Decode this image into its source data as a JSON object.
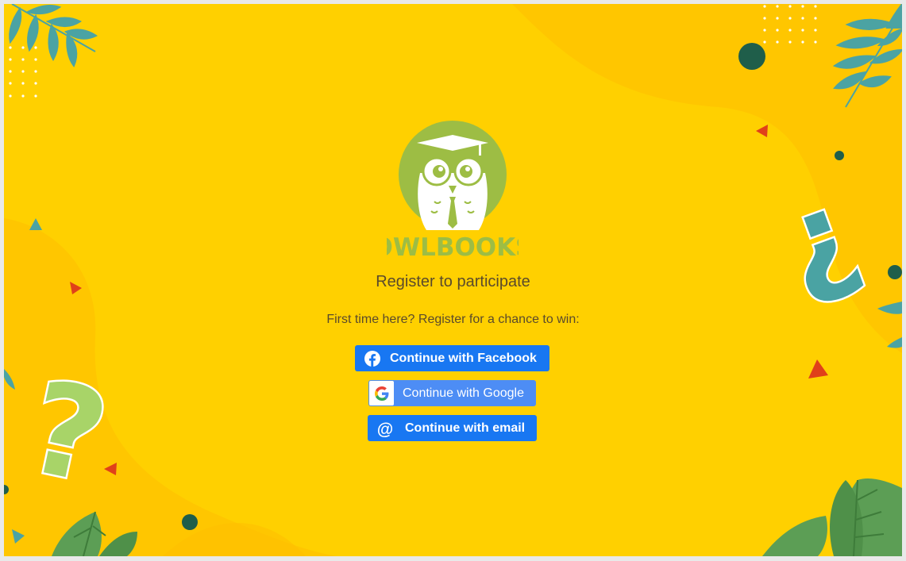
{
  "brand": {
    "name": "OWLBOOKS"
  },
  "register": {
    "title": "Register to participate",
    "subtitle": "First time here? Register for a chance to win:"
  },
  "buttons": {
    "facebook": {
      "label": "Continue with Facebook",
      "icon": "facebook-icon"
    },
    "google": {
      "label": "Continue with Google",
      "icon": "google-icon"
    },
    "email": {
      "label": "Continue with email",
      "icon": "at-sign-icon",
      "icon_glyph": "@"
    }
  },
  "decor": {
    "left_mark": "?",
    "right_mark": "¿"
  },
  "colors": {
    "background": "#ffd000",
    "facebook": "#1877f2",
    "google": "#4d8df5",
    "logo_green": "#9dbd44",
    "text": "#5a4a2c"
  }
}
